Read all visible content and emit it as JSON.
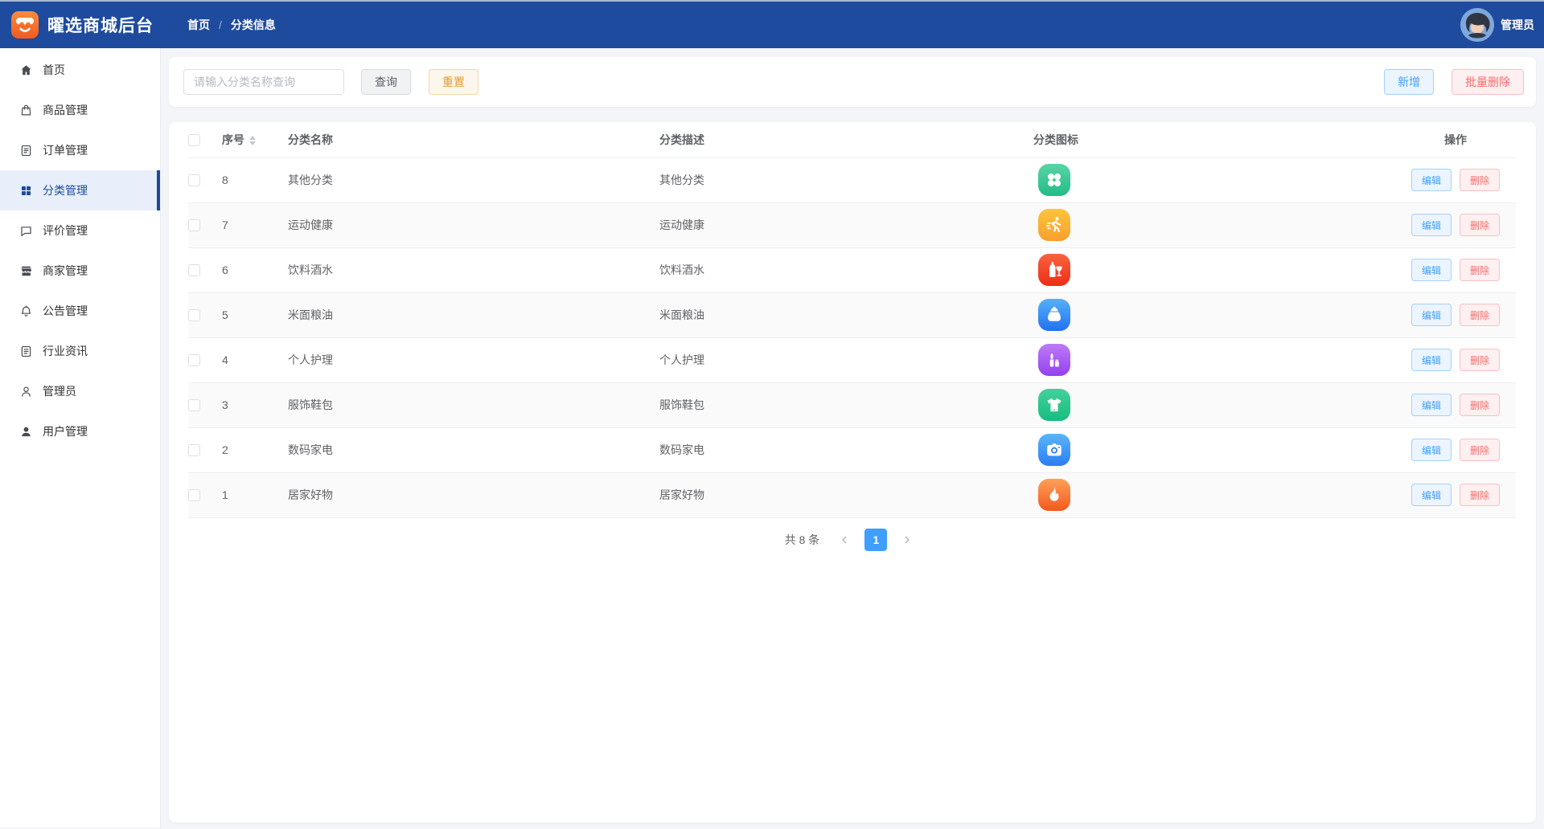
{
  "header": {
    "title": "曜选商城后台",
    "breadcrumb": {
      "home": "首页",
      "separator": "/",
      "current": "分类信息"
    },
    "user_name": "管理员",
    "bg_color": "#1e4b9d"
  },
  "sidebar": {
    "items": [
      {
        "key": "home",
        "label": "首页",
        "icon": "home-icon",
        "active": false
      },
      {
        "key": "goods",
        "label": "商品管理",
        "icon": "goods-bag-icon",
        "active": false
      },
      {
        "key": "orders",
        "label": "订单管理",
        "icon": "order-doc-icon",
        "active": false
      },
      {
        "key": "category",
        "label": "分类管理",
        "icon": "category-grid-icon",
        "active": true
      },
      {
        "key": "reviews",
        "label": "评价管理",
        "icon": "comment-icon",
        "active": false
      },
      {
        "key": "merchant",
        "label": "商家管理",
        "icon": "storefront-icon",
        "active": false
      },
      {
        "key": "notice",
        "label": "公告管理",
        "icon": "bell-icon",
        "active": false
      },
      {
        "key": "news",
        "label": "行业资讯",
        "icon": "news-doc-icon",
        "active": false
      },
      {
        "key": "admin",
        "label": "管理员",
        "icon": "admin-person-icon",
        "active": false
      },
      {
        "key": "users",
        "label": "用户管理",
        "icon": "user-person-icon",
        "active": false
      }
    ]
  },
  "toolbar": {
    "search_placeholder": "请输入分类名称查询",
    "query_label": "查询",
    "reset_label": "重置",
    "add_label": "新增",
    "batch_delete_label": "批量删除"
  },
  "table": {
    "headers": {
      "index": "序号",
      "name": "分类名称",
      "desc": "分类描述",
      "icon": "分类图标",
      "actions": "操作"
    },
    "edit_label": "编辑",
    "delete_label": "删除",
    "rows": [
      {
        "index": "8",
        "name": "其他分类",
        "desc": "其他分类",
        "icon": "clover-icon",
        "gradient": [
          "#5ad3a5",
          "#21bd87"
        ]
      },
      {
        "index": "7",
        "name": "运动健康",
        "desc": "运动健康",
        "icon": "runner-icon",
        "gradient": [
          "#fdc53c",
          "#f89f2c"
        ]
      },
      {
        "index": "6",
        "name": "饮料酒水",
        "desc": "饮料酒水",
        "icon": "bottle-wine-icon",
        "gradient": [
          "#f9633f",
          "#ee2d17"
        ]
      },
      {
        "index": "5",
        "name": "米面粮油",
        "desc": "米面粮油",
        "icon": "rice-bag-icon",
        "gradient": [
          "#55b1fb",
          "#2470f0"
        ]
      },
      {
        "index": "4",
        "name": "个人护理",
        "desc": "个人护理",
        "icon": "lipstick-icon",
        "gradient": [
          "#bd7bf8",
          "#9440ee"
        ]
      },
      {
        "index": "3",
        "name": "服饰鞋包",
        "desc": "服饰鞋包",
        "icon": "tshirt-icon",
        "gradient": [
          "#43d19b",
          "#17bd80"
        ]
      },
      {
        "index": "2",
        "name": "数码家电",
        "desc": "数码家电",
        "icon": "camera-icon",
        "gradient": [
          "#5ab5fa",
          "#2b7ef4"
        ]
      },
      {
        "index": "1",
        "name": "居家好物",
        "desc": "居家好物",
        "icon": "flame-icon",
        "gradient": [
          "#ffa159",
          "#f4581d"
        ]
      }
    ]
  },
  "pagination": {
    "total_text": "共 8 条",
    "current_page": "1"
  },
  "colors": {
    "primary": "#409eff",
    "danger": "#f56c6c",
    "warning": "#e6a23c",
    "nav_active": "#1d4a9b",
    "logo_orange": "#f25a21"
  }
}
